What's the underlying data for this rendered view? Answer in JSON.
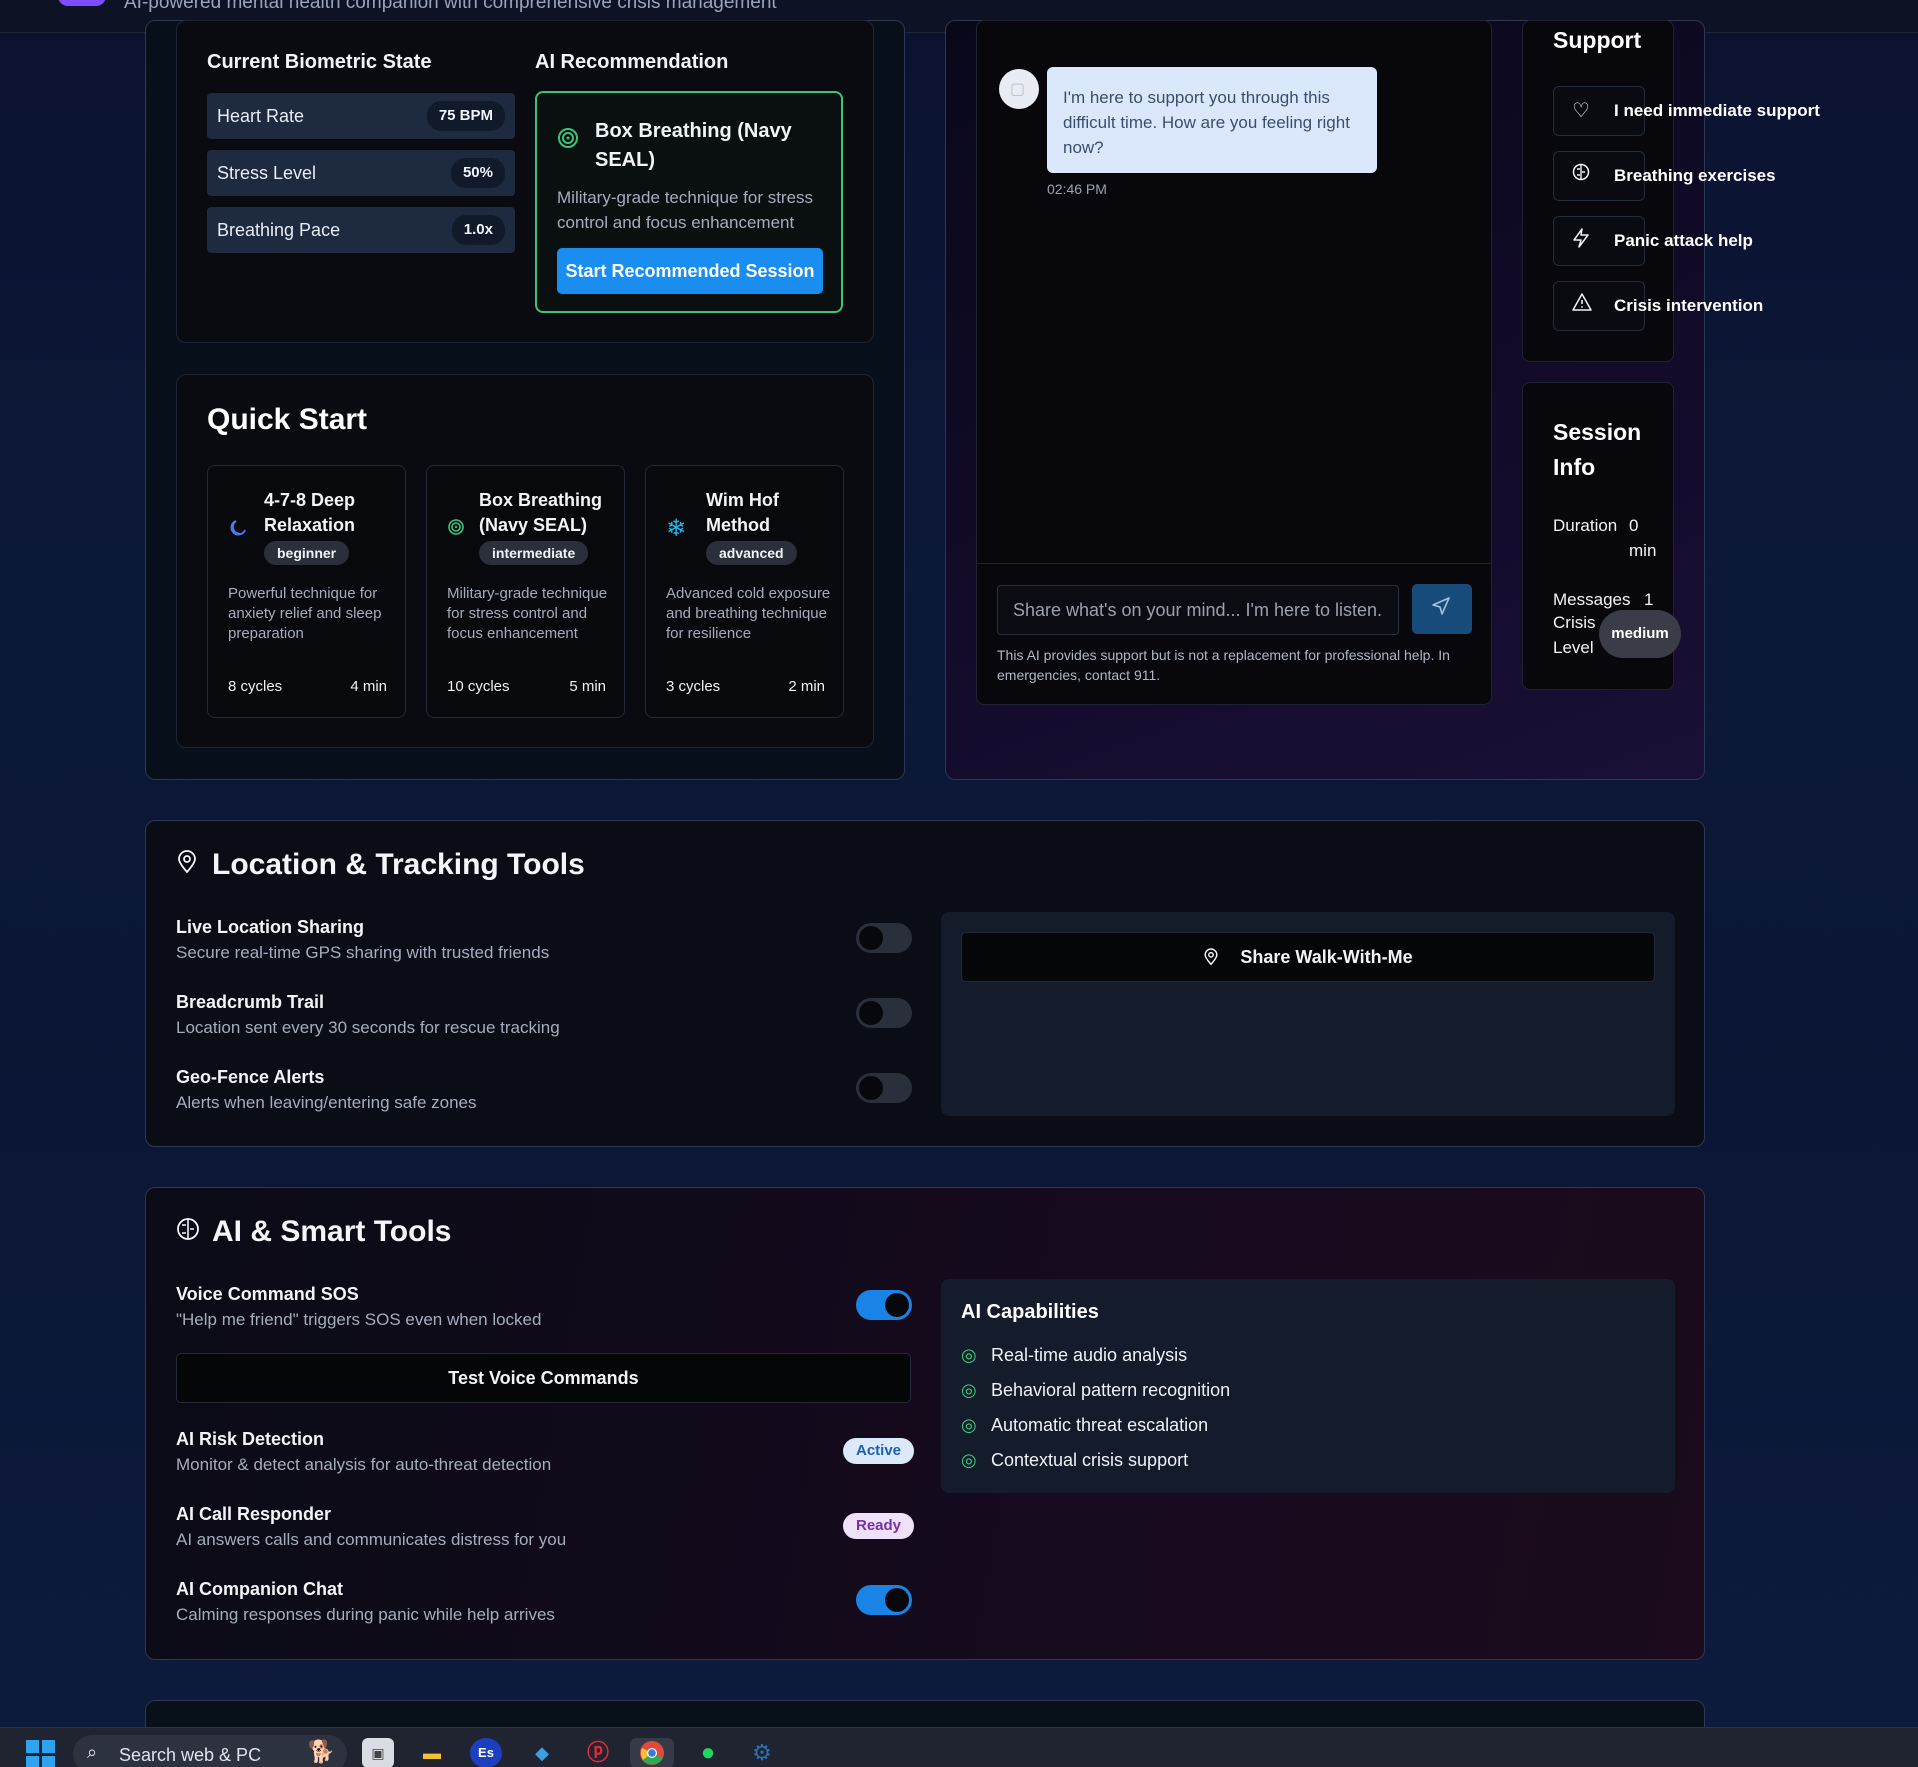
{
  "header": {
    "subtitle": "AI-powered mental health companion with comprehensive crisis management"
  },
  "biometric": {
    "title": "Current Biometric State",
    "metrics": [
      {
        "label": "Heart Rate",
        "value": "75 BPM"
      },
      {
        "label": "Stress Level",
        "value": "50%"
      },
      {
        "label": "Breathing Pace",
        "value": "1.0x"
      }
    ]
  },
  "recommendation": {
    "title": "AI Recommendation",
    "technique": "Box Breathing (Navy SEAL)",
    "description": "Military-grade technique for stress control and focus enhancement",
    "button": "Start Recommended Session"
  },
  "quick_start": {
    "title": "Quick Start",
    "items": [
      {
        "name": "4-7-8 Deep Relaxation",
        "level": "beginner",
        "description": "Powerful technique for anxiety relief and sleep preparation",
        "cycles": "8 cycles",
        "duration": "4 min",
        "icon": "moon-icon",
        "color": "#4a7cf0"
      },
      {
        "name": "Box Breathing (Navy SEAL)",
        "level": "intermediate",
        "description": "Military-grade technique for stress control and focus enhancement",
        "cycles": "10 cycles",
        "duration": "5 min",
        "icon": "target-icon",
        "color": "#3cc47c"
      },
      {
        "name": "Wim Hof Method",
        "level": "advanced",
        "description": "Advanced cold exposure and breathing technique for resilience",
        "cycles": "3 cycles",
        "duration": "2 min",
        "icon": "snowflake-icon",
        "color": "#2bb3e6"
      }
    ]
  },
  "chat": {
    "message": "I'm here to support you through this difficult time. How are you feeling right now?",
    "time": "02:46 PM",
    "placeholder": "Share what's on your mind... I'm here to listen.",
    "disclaimer": "This AI provides support but is not a replacement for professional help. In emergencies, contact 911."
  },
  "support": {
    "title": "Support",
    "options": [
      {
        "label": "I need immediate support",
        "icon": "heart-icon"
      },
      {
        "label": "Breathing exercises",
        "icon": "brain-icon"
      },
      {
        "label": "Panic attack help",
        "icon": "lightning-icon"
      },
      {
        "label": "Crisis intervention",
        "icon": "warning-icon"
      }
    ]
  },
  "session": {
    "title": "Session Info",
    "duration_label": "Duration",
    "duration_value": "0 min",
    "messages_label": "Messages",
    "messages_value": "1",
    "crisis_label": "Crisis Level",
    "crisis_value": "medium"
  },
  "location": {
    "title": "Location & Tracking Tools",
    "features": [
      {
        "name": "Live Location Sharing",
        "description": "Secure real-time GPS sharing with trusted friends",
        "enabled": false
      },
      {
        "name": "Breadcrumb Trail",
        "description": "Location sent every 30 seconds for rescue tracking",
        "enabled": false
      },
      {
        "name": "Geo-Fence Alerts",
        "description": "Alerts when leaving/entering safe zones",
        "enabled": false
      }
    ],
    "share_button": "Share Walk-With-Me"
  },
  "ai_tools": {
    "title": "AI & Smart Tools",
    "voice": {
      "name": "Voice Command SOS",
      "description": "\"Help me friend\" triggers SOS even when locked",
      "enabled": true
    },
    "test_button": "Test Voice Commands",
    "risk": {
      "name": "AI Risk Detection",
      "description": "Monitor & detect analysis for auto-threat detection",
      "status": "Active"
    },
    "call": {
      "name": "AI Call Responder",
      "description": "AI answers calls and communicates distress for you",
      "status": "Ready"
    },
    "companion": {
      "name": "AI Companion Chat",
      "description": "Calming responses during panic while help arrives",
      "enabled": true
    },
    "capabilities_title": "AI Capabilities",
    "capabilities": [
      "Real-time audio analysis",
      "Behavioral pattern recognition",
      "Automatic threat escalation",
      "Contextual crisis support"
    ]
  },
  "taskbar": {
    "search": "Search web & PC"
  }
}
